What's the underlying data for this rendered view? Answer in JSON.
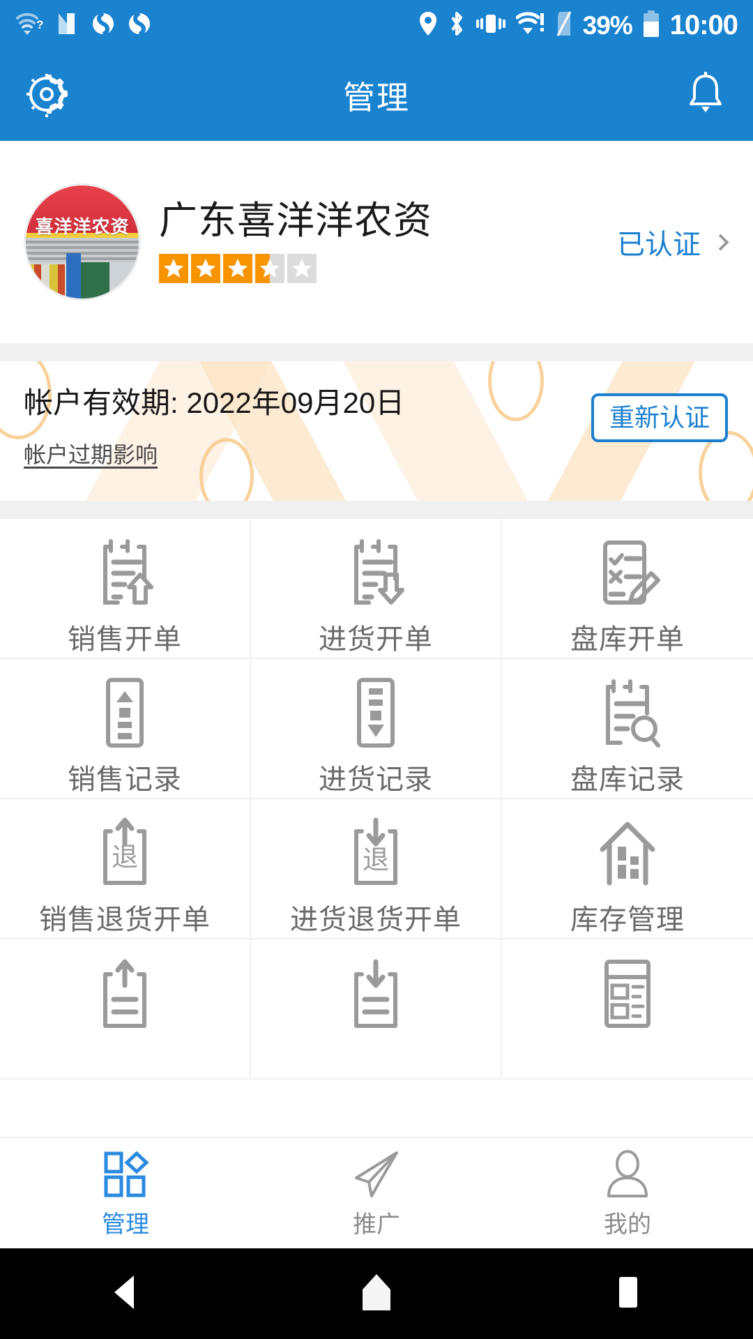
{
  "status_bar": {
    "icons_left": [
      "wifi-question-icon",
      "nfc-n-icon",
      "sync-icon",
      "sync-icon"
    ],
    "icons_right": [
      "location-icon",
      "bluetooth-icon",
      "vibrate-icon",
      "wifi-alert-icon",
      "sim-card-icon"
    ],
    "battery_percent": "39%",
    "battery_icon": "battery-icon",
    "clock": "10:00"
  },
  "app_bar": {
    "settings_icon": "gear-icon",
    "title": "管理",
    "notification_icon": "bell-icon"
  },
  "shop": {
    "avatar_icon": "shop-photo-avatar",
    "avatar_sign_text": "喜洋洋农资",
    "name": "广东喜洋洋农资",
    "rating": 3.5,
    "stars_total": 5,
    "verify_label": "已认证",
    "verify_chevron_icon": "chevron-right-icon"
  },
  "account": {
    "validity_label": "帐户有效期: 2022年09月20日",
    "expire_link": "帐户过期影响",
    "recertify_button": "重新认证",
    "accent_color": "#1a7fd0",
    "banner_decor_color": "#f7c98a"
  },
  "grid": {
    "items": [
      {
        "label": "销售开单",
        "icon": "document-up-arrow-icon"
      },
      {
        "label": "进货开单",
        "icon": "document-down-arrow-icon"
      },
      {
        "label": "盘库开单",
        "icon": "checklist-pencil-icon"
      },
      {
        "label": "销售记录",
        "icon": "stock-out-record-icon"
      },
      {
        "label": "进货记录",
        "icon": "stock-in-record-icon"
      },
      {
        "label": "盘库记录",
        "icon": "document-search-icon"
      },
      {
        "label": "销售退货开单",
        "icon": "return-up-arrow-icon"
      },
      {
        "label": "进货退货开单",
        "icon": "return-down-arrow-icon"
      },
      {
        "label": "库存管理",
        "icon": "warehouse-house-icon"
      },
      {
        "label": "",
        "icon": "document-up-arrow-icon"
      },
      {
        "label": "",
        "icon": "document-down-arrow-icon"
      },
      {
        "label": "",
        "icon": "report-list-icon"
      }
    ],
    "return_glyph": "退"
  },
  "bottom_nav": {
    "items": [
      {
        "label": "管理",
        "icon": "grid-shapes-icon",
        "active": true
      },
      {
        "label": "推广",
        "icon": "paper-plane-icon",
        "active": false
      },
      {
        "label": "我的",
        "icon": "person-icon",
        "active": false
      }
    ],
    "active_color": "#2a8ae0"
  },
  "android_nav": {
    "back_icon": "back-triangle-icon",
    "home_icon": "home-pentagon-icon",
    "recents_icon": "recents-square-icon"
  },
  "theme": {
    "primary": "#1a83d0",
    "star_filled": "#f79400",
    "star_empty": "#dcdcdc",
    "icon_gray": "#9a9a9a"
  }
}
